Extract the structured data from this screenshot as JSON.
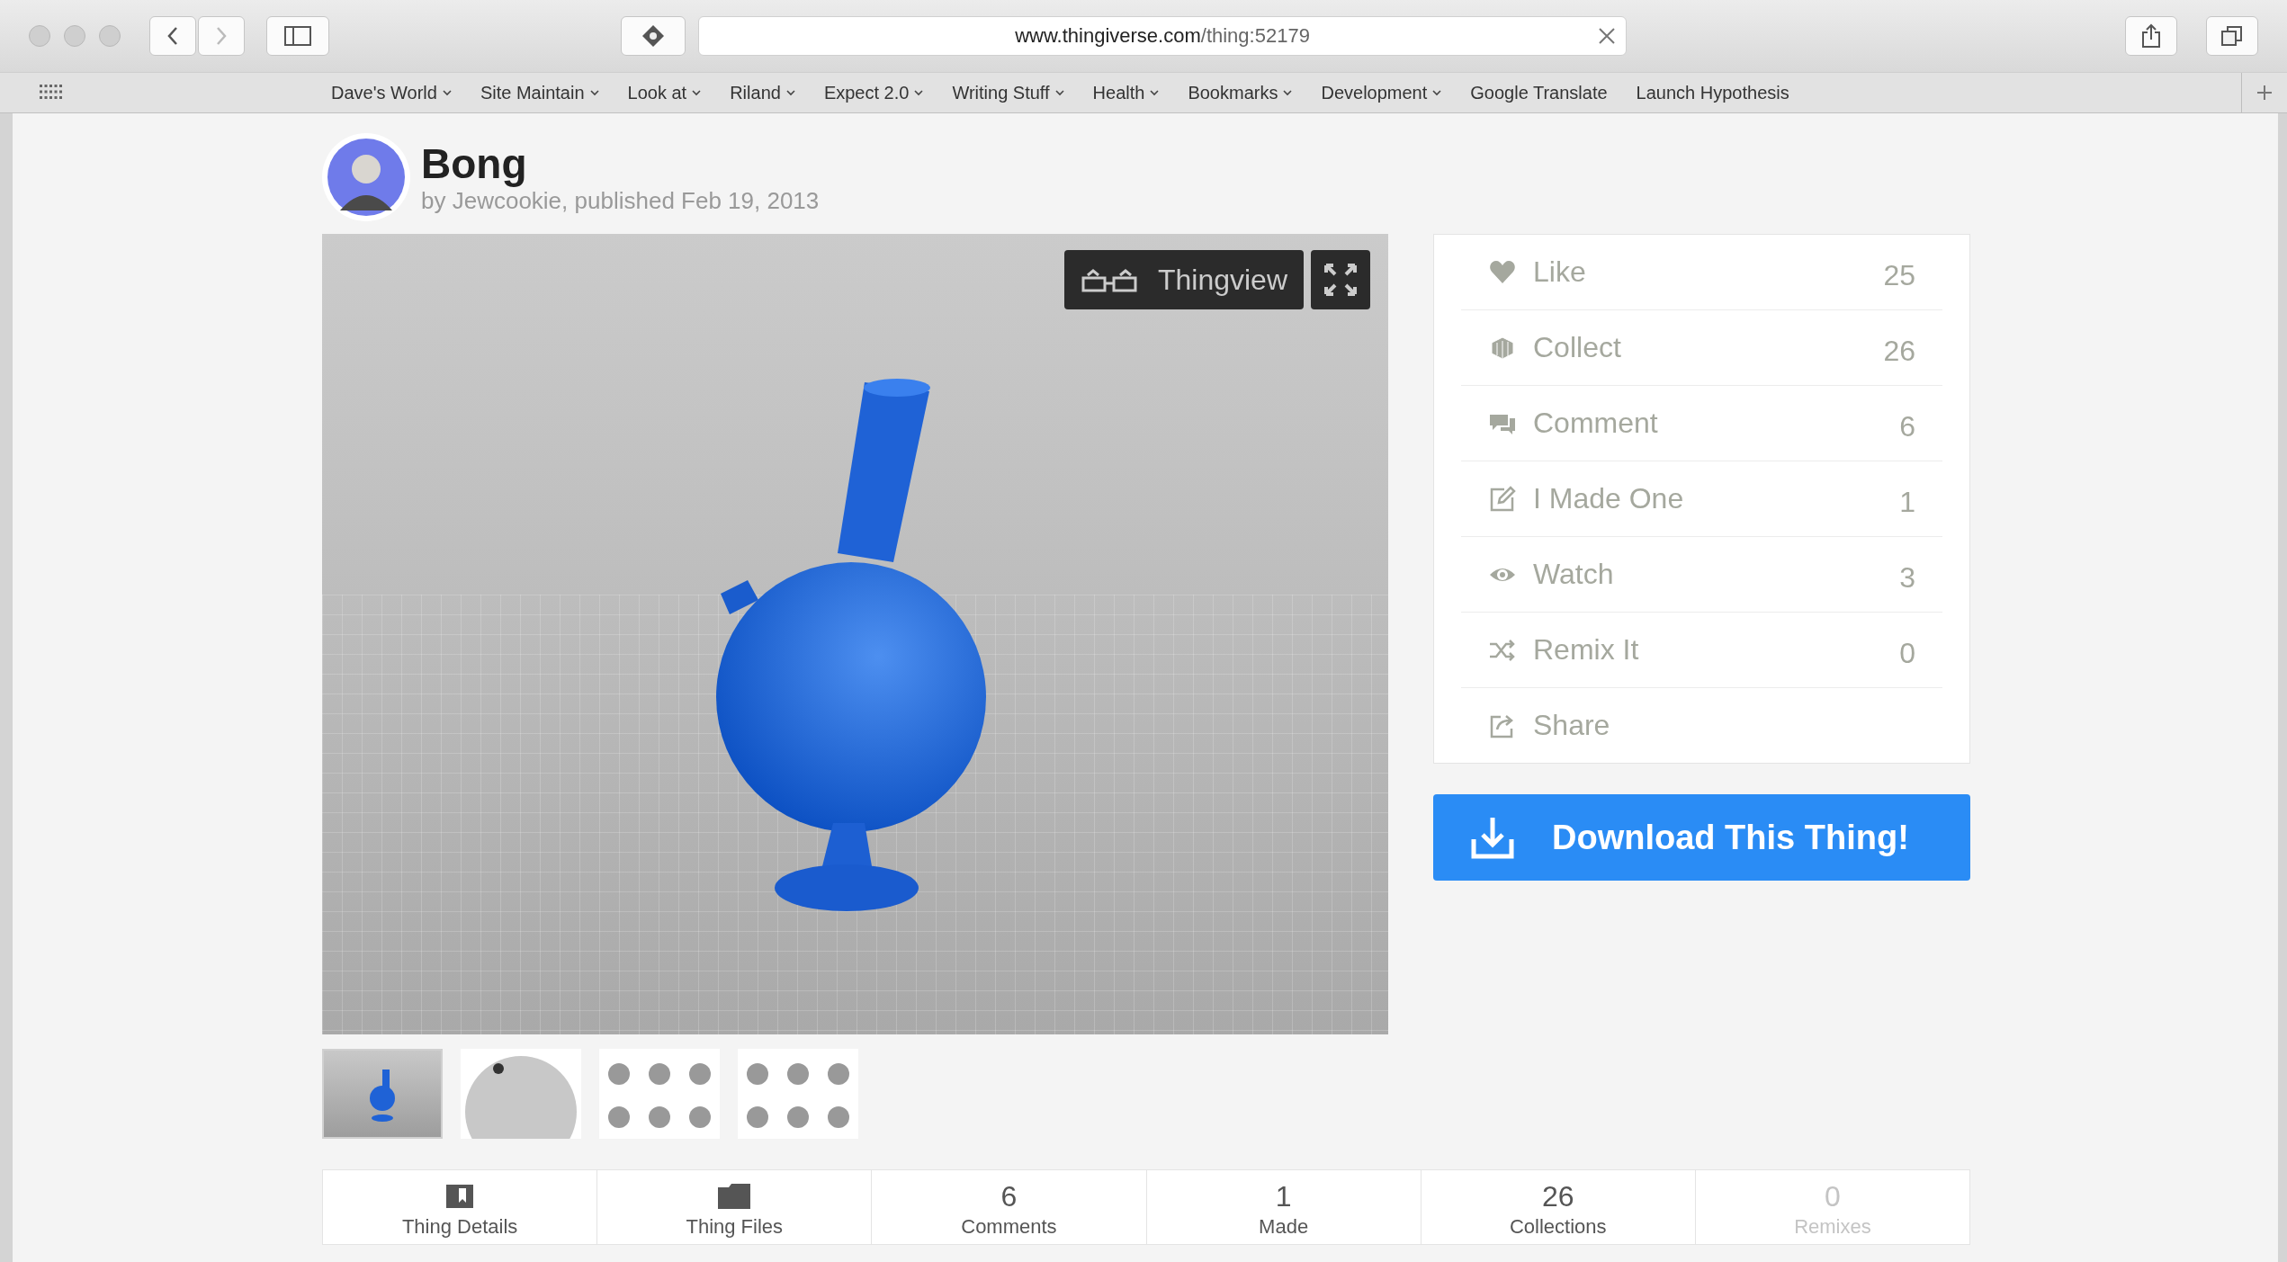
{
  "browser": {
    "url_host": "www.thingiverse.com",
    "url_path": "/thing:52179",
    "bookmarks": [
      {
        "label": "Dave's World",
        "has_menu": true
      },
      {
        "label": "Site Maintain",
        "has_menu": true
      },
      {
        "label": "Look at",
        "has_menu": true
      },
      {
        "label": "Riland",
        "has_menu": true
      },
      {
        "label": "Expect 2.0",
        "has_menu": true
      },
      {
        "label": "Writing Stuff",
        "has_menu": true
      },
      {
        "label": "Health",
        "has_menu": true
      },
      {
        "label": "Bookmarks",
        "has_menu": true
      },
      {
        "label": "Development",
        "has_menu": true
      },
      {
        "label": "Google Translate",
        "has_menu": false
      },
      {
        "label": "Launch Hypothesis",
        "has_menu": false
      }
    ]
  },
  "thing": {
    "title": "Bong",
    "byline": "by Jewcookie, published Feb 19, 2013"
  },
  "viewer": {
    "thingview_label": "Thingview"
  },
  "actions": [
    {
      "kind": "like",
      "label": "Like",
      "count": "25"
    },
    {
      "kind": "collect",
      "label": "Collect",
      "count": "26"
    },
    {
      "kind": "comment",
      "label": "Comment",
      "count": "6"
    },
    {
      "kind": "made",
      "label": "I Made One",
      "count": "1"
    },
    {
      "kind": "watch",
      "label": "Watch",
      "count": "3"
    },
    {
      "kind": "remix",
      "label": "Remix It",
      "count": "0"
    },
    {
      "kind": "share",
      "label": "Share"
    }
  ],
  "download_button": "Download This Thing!",
  "thumbnails": [
    {
      "kind": "render",
      "selected": true
    },
    {
      "kind": "closeup",
      "selected": false
    },
    {
      "kind": "grid",
      "selected": false
    },
    {
      "kind": "grid",
      "selected": false
    }
  ],
  "tabs": [
    {
      "kind": "details",
      "label": "Thing Details",
      "disabled": false
    },
    {
      "kind": "files",
      "label": "Thing Files",
      "disabled": false
    },
    {
      "kind": "count",
      "count": "6",
      "label": "Comments",
      "disabled": false
    },
    {
      "kind": "count",
      "count": "1",
      "label": "Made",
      "disabled": false
    },
    {
      "kind": "count",
      "count": "26",
      "label": "Collections",
      "disabled": false
    },
    {
      "kind": "count",
      "count": "0",
      "label": "Remixes",
      "disabled": true
    }
  ]
}
